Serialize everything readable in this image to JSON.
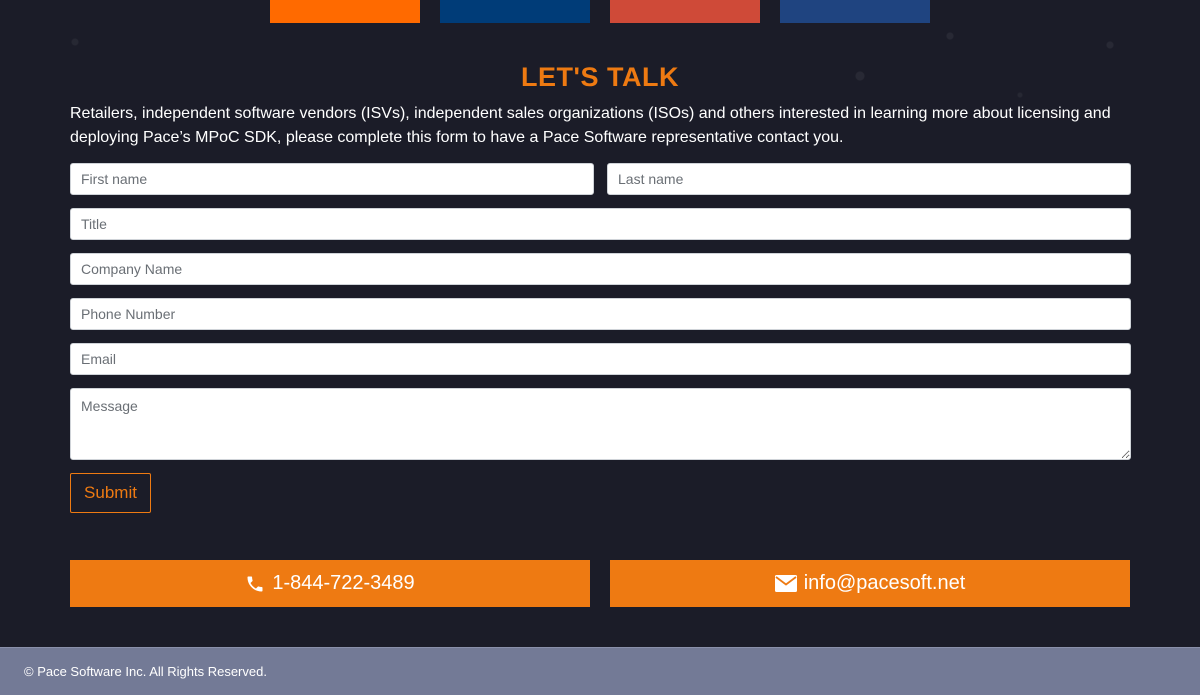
{
  "colors": {
    "accent": "#ee7a12",
    "background": "#1b1c28",
    "footer": "#737a96",
    "tiles": [
      "#ff6a00",
      "#003c78",
      "#cf4a38",
      "#1f4480"
    ]
  },
  "contact_section": {
    "heading": "LET'S TALK",
    "intro": "Retailers, independent software vendors (ISVs), independent sales organizations (ISOs) and others interested in learning more about licensing and deploying Pace’s MPoC SDK, please complete this form to have a Pace Software representative contact you."
  },
  "form": {
    "first_name_placeholder": "First name",
    "last_name_placeholder": "Last name",
    "title_placeholder": "Title",
    "company_placeholder": "Company Name",
    "phone_placeholder": "Phone Number",
    "email_placeholder": "Email",
    "message_placeholder": "Message",
    "submit_label": "Submit"
  },
  "contact_buttons": {
    "phone": {
      "icon": "phone-icon",
      "label": "1-844-722-3489"
    },
    "email": {
      "icon": "envelope-icon",
      "label": "info@pacesoft.net"
    }
  },
  "footer": {
    "copyright": "© Pace Software Inc. All Rights Reserved."
  }
}
